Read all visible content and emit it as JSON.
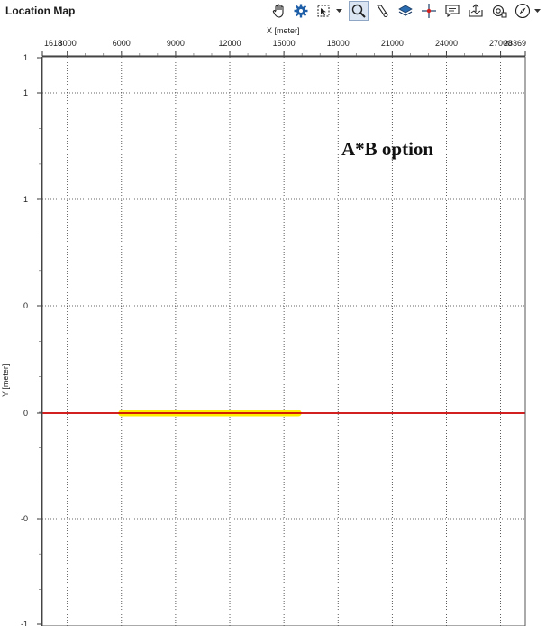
{
  "window": {
    "title": "Location Map"
  },
  "toolbar": {
    "icons": [
      "hand-icon",
      "gear-icon",
      "select-area-icon",
      "zoom-icon",
      "pick-icon",
      "layers-icon",
      "crosshair-icon",
      "comment-icon",
      "export-icon",
      "camera-icon",
      "compass-icon"
    ]
  },
  "chart_data": {
    "type": "line",
    "annotation": "A*B option",
    "xlabel": "X [meter]",
    "ylabel": "Y [meter]",
    "x_ticks": [
      "1618",
      "3000",
      "6000",
      "9000",
      "12000",
      "15000",
      "18000",
      "21000",
      "24000",
      "27000",
      "28369"
    ],
    "x_tick_values": [
      1618,
      3000,
      6000,
      9000,
      12000,
      15000,
      18000,
      21000,
      24000,
      27000,
      28369
    ],
    "y_ticks": [
      "1",
      "1",
      "1",
      "0",
      "0",
      "-0",
      "-1"
    ],
    "xlim": [
      1618,
      28369
    ],
    "grid": true,
    "series": [
      {
        "color": "#cc0000",
        "x": [
          1618,
          28369
        ],
        "y": [
          0,
          0
        ]
      },
      {
        "color": "#ffee00",
        "x": [
          6000,
          15800
        ],
        "y": [
          0,
          0
        ]
      }
    ]
  },
  "colors": {
    "grid": "#333333",
    "line": "#cc0000",
    "highlight": "#ffee00"
  }
}
